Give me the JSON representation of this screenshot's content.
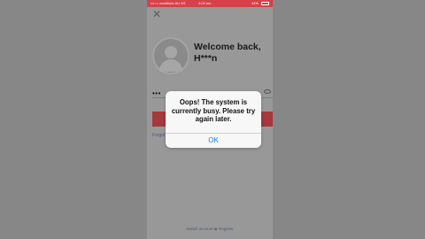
{
  "status_bar": {
    "carrier": "•••○○ vodafone AU  4G",
    "time": "4:04 am",
    "battery": "44%"
  },
  "welcome": {
    "line1": "Welcome back,",
    "line2": "H***n"
  },
  "password": {
    "dots": "•••"
  },
  "forgot_label": "Forgot",
  "footer": {
    "switch_account": "Switch account",
    "or": "or",
    "register": "Register"
  },
  "dialog": {
    "message": "Oops! The system is currently busy. Please try again later.",
    "ok_label": "OK"
  },
  "colors": {
    "status_bar": "#d6414a",
    "primary_button": "#a5383d",
    "dialog_action": "#1a7cf2"
  }
}
